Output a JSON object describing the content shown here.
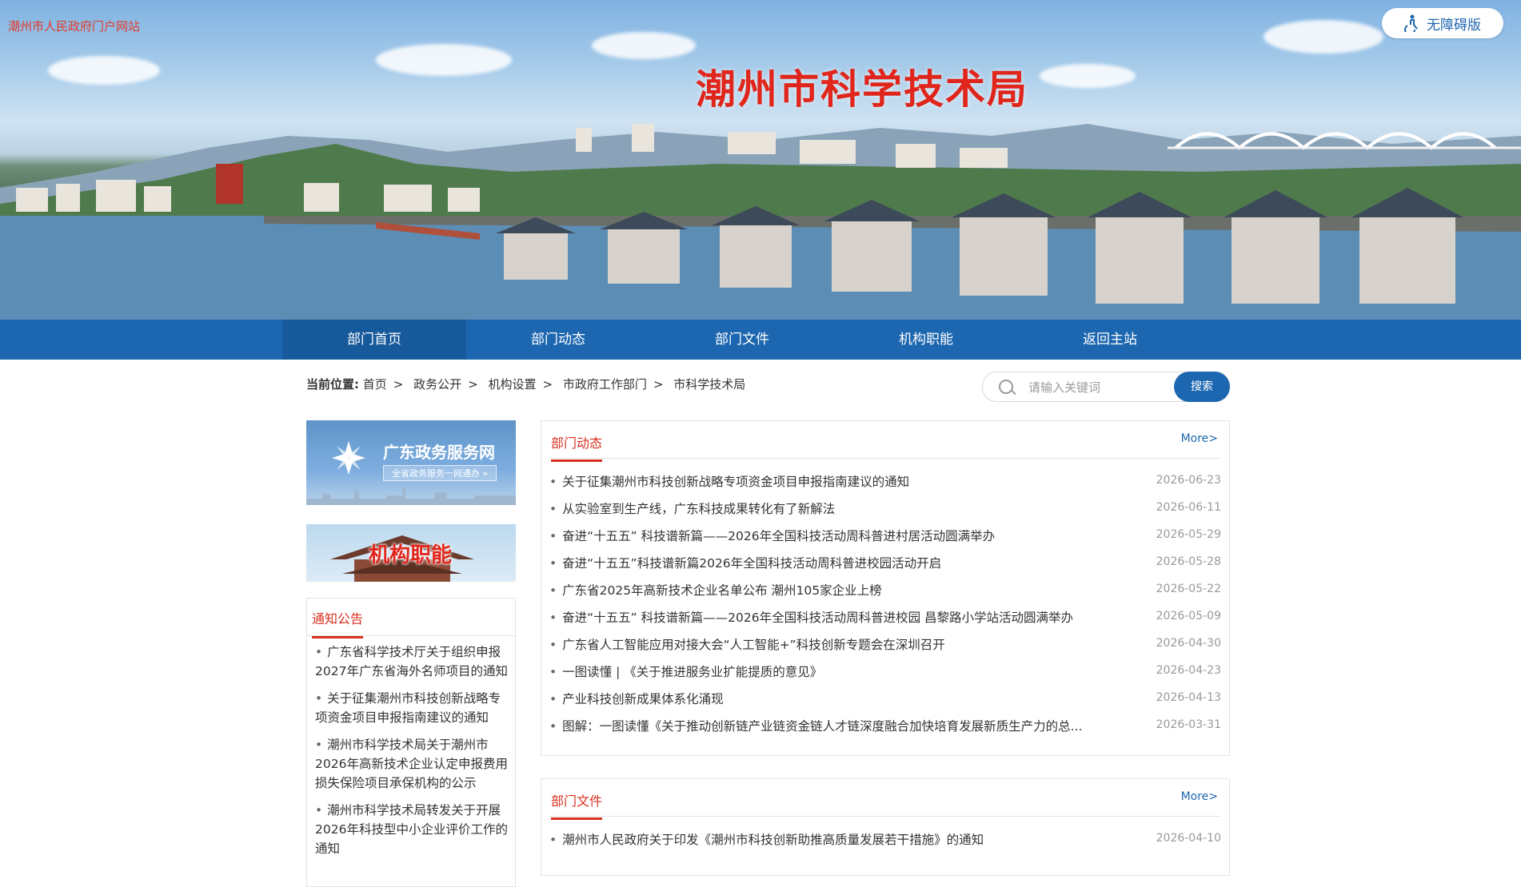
{
  "header": {
    "portal_link": "潮州市人民政府门户网站",
    "accessibility": "无障碍版",
    "site_title": "潮州市科学技术局"
  },
  "nav": [
    "部门首页",
    "部门动态",
    "部门文件",
    "机构职能",
    "返回主站"
  ],
  "breadcrumb": {
    "label": "当前位置:",
    "items": [
      "首页",
      "政务公开",
      "机构设置",
      "市政府工作部门",
      "市科学技术局"
    ],
    "separator": ">"
  },
  "search": {
    "placeholder": "请输入关键词",
    "button": "搜索"
  },
  "sidebar": {
    "promo1_title": "广东政务服务网",
    "promo1_sub": "全省政务服务一网通办 »",
    "promo2_title": "机构职能",
    "notice_title": "通知公告",
    "notices": [
      "广东省科学技术厅关于组织申报2027年广东省海外名师项目的通知",
      "关于征集潮州市科技创新战略专项资金项目申报指南建议的通知",
      "潮州市科学技术局关于潮州市2026年高新技术企业认定申报费用损失保险项目承保机构的公示",
      "潮州市科学技术局转发关于开展2026年科技型中小企业评价工作的通知"
    ]
  },
  "news": {
    "title": "部门动态",
    "more": "More>",
    "items": [
      {
        "title": "关于征集潮州市科技创新战略专项资金项目申报指南建议的通知",
        "date": "2026-06-23"
      },
      {
        "title": "从实验室到生产线，广东科技成果转化有了新解法",
        "date": "2026-06-11"
      },
      {
        "title": "奋进“十五五” 科技谱新篇——2026年全国科技活动周科普进村居活动圆满举办",
        "date": "2026-05-29"
      },
      {
        "title": "奋进“十五五”科技谱新篇2026年全国科技活动周科普进校园活动开启",
        "date": "2026-05-28"
      },
      {
        "title": "广东省2025年高新技术企业名单公布 潮州105家企业上榜",
        "date": "2026-05-22"
      },
      {
        "title": "奋进“十五五” 科技谱新篇——2026年全国科技活动周科普进校园 昌黎路小学站活动圆满举办",
        "date": "2026-05-09"
      },
      {
        "title": "广东省人工智能应用对接大会“人工智能+”科技创新专题会在深圳召开",
        "date": "2026-04-30"
      },
      {
        "title": "一图读懂 | 《关于推进服务业扩能提质的意见》",
        "date": "2026-04-23"
      },
      {
        "title": "产业科技创新成果体系化涌现",
        "date": "2026-04-13"
      },
      {
        "title": "图解：一图读懂《关于推动创新链产业链资金链人才链深度融合加快培育发展新质生产力的总...",
        "date": "2026-03-31"
      }
    ]
  },
  "docs": {
    "title": "部门文件",
    "more": "More>",
    "items": [
      {
        "title": "潮州市人民政府关于印发《潮州市科技创新助推高质量发展若干措施》的通知",
        "date": "2026-04-10"
      }
    ]
  }
}
